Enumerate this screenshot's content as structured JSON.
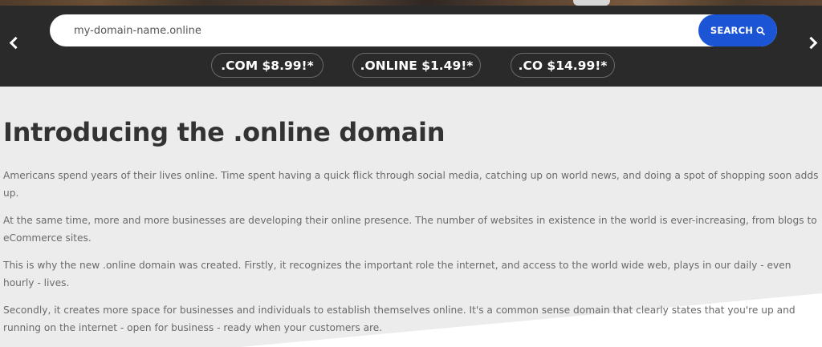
{
  "search": {
    "value": "my-domain-name.online",
    "button_label": "SEARCH",
    "button_color": "#1b55d6"
  },
  "icons": {
    "prev": "chevron-left-icon",
    "next": "chevron-right-icon",
    "search": "magnifier-icon"
  },
  "tld_offers": [
    {
      "label": ".COM $8.99!*"
    },
    {
      "label": ".ONLINE $1.49!*"
    },
    {
      "label": ".CO $14.99!*"
    }
  ],
  "article": {
    "title": "Introducing the .online domain",
    "paragraphs": [
      "Americans spend years of their lives online. Time spent having a quick flick through social media, catching up on world news, and doing a spot of shopping soon adds up.",
      "At the same time, more and more businesses are developing their online presence. The number of websites in existence in the world is ever-increasing, from blogs to eCommerce sites.",
      "This is why the new .online domain was created. Firstly, it recognizes the important role the internet, and access to the world wide web, plays in our daily - even hourly - lives.",
      "Secondly, it creates more space for businesses and individuals to establish themselves online. It's a common sense domain that clearly states that you're up and running on the internet - open for business - ready when your customers are."
    ]
  }
}
